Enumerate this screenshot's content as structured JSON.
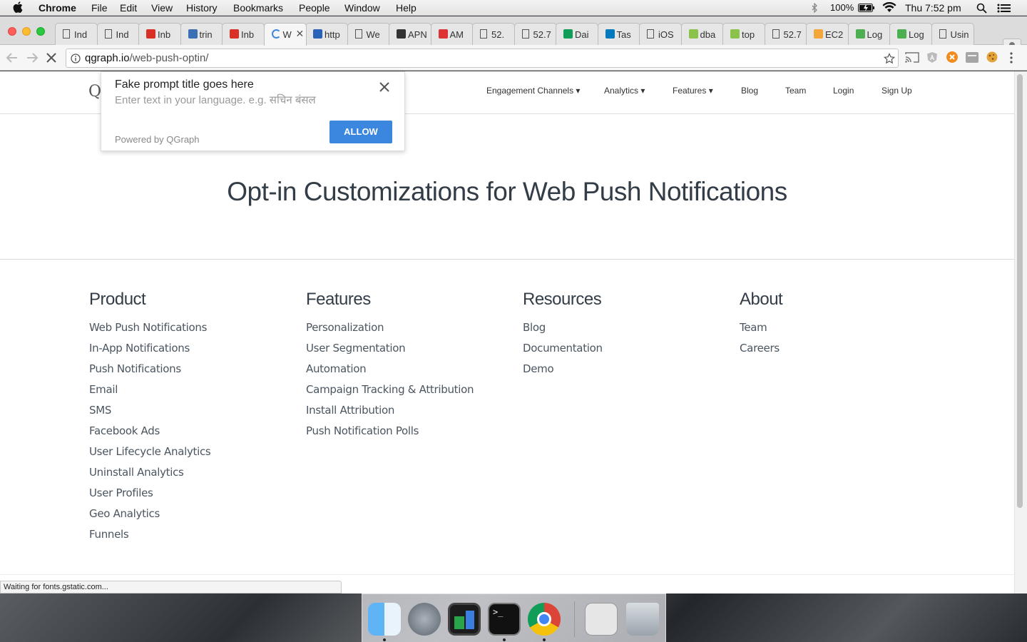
{
  "menubar": {
    "app": "Chrome",
    "items": [
      "File",
      "Edit",
      "View",
      "History",
      "Bookmarks",
      "People",
      "Window",
      "Help"
    ],
    "battery": "100%",
    "clock": "Thu 7:52 pm"
  },
  "tabs": [
    {
      "label": "Ind",
      "icon": "doc-icon"
    },
    {
      "label": "Ind",
      "icon": "doc-icon"
    },
    {
      "label": "Inb",
      "icon": "gmail-icon"
    },
    {
      "label": "trin",
      "icon": "shield-icon"
    },
    {
      "label": "Inb",
      "icon": "gmail-icon"
    },
    {
      "label": "W",
      "icon": "loading-icon",
      "active": true
    },
    {
      "label": "http",
      "icon": "citi-icon"
    },
    {
      "label": "We",
      "icon": "doc-icon"
    },
    {
      "label": "APN",
      "icon": "apple-icon"
    },
    {
      "label": "AM",
      "icon": "red-arrow-icon"
    },
    {
      "label": "52.",
      "icon": "doc-icon"
    },
    {
      "label": "52.7",
      "icon": "doc-icon"
    },
    {
      "label": "Dai",
      "icon": "sheets-icon"
    },
    {
      "label": "Tas",
      "icon": "trello-icon"
    },
    {
      "label": "iOS",
      "icon": "doc-icon"
    },
    {
      "label": "dba",
      "icon": "bars-icon"
    },
    {
      "label": "top",
      "icon": "bars-icon"
    },
    {
      "label": "52.7",
      "icon": "doc-icon"
    },
    {
      "label": "EC2",
      "icon": "aws-icon"
    },
    {
      "label": "Log",
      "icon": "leaf-icon"
    },
    {
      "label": "Log",
      "icon": "leaf-icon"
    },
    {
      "label": "Usin",
      "icon": "doc-icon"
    }
  ],
  "address": {
    "host": "qgraph.io",
    "path": "/web-push-optin/"
  },
  "site": {
    "logo": "Q",
    "nav": [
      "Engagement Channels ▾",
      "Analytics ▾",
      "Features ▾",
      "Blog",
      "Team",
      "Login",
      "Sign Up"
    ],
    "heading": "Opt-in Customizations for Web Push Notifications",
    "footer": [
      {
        "title": "Product",
        "links": [
          "Web Push Notifications",
          "In-App Notifications",
          "Push Notifications",
          "Email",
          "SMS",
          "Facebook Ads",
          "User Lifecycle Analytics",
          "Uninstall Analytics",
          "User Profiles",
          "Geo Analytics",
          "Funnels"
        ]
      },
      {
        "title": "Features",
        "links": [
          "Personalization",
          "User Segmentation",
          "Automation",
          "Campaign Tracking & Attribution",
          "Install Attribution",
          "Push Notification Polls"
        ]
      },
      {
        "title": "Resources",
        "links": [
          "Blog",
          "Documentation",
          "Demo"
        ]
      },
      {
        "title": "About",
        "links": [
          "Team",
          "Careers"
        ]
      }
    ]
  },
  "prompt": {
    "title": "Fake prompt title goes here",
    "placeholder": "Enter text in your language. e.g. सचिन बंसल",
    "powered_by": "Powered by QGraph",
    "allow": "ALLOW"
  },
  "status": "Waiting for fonts.gstatic.com...",
  "colors": {
    "allow_button": "#3b87e0",
    "heading": "#333d47",
    "link": "#4a5560"
  }
}
